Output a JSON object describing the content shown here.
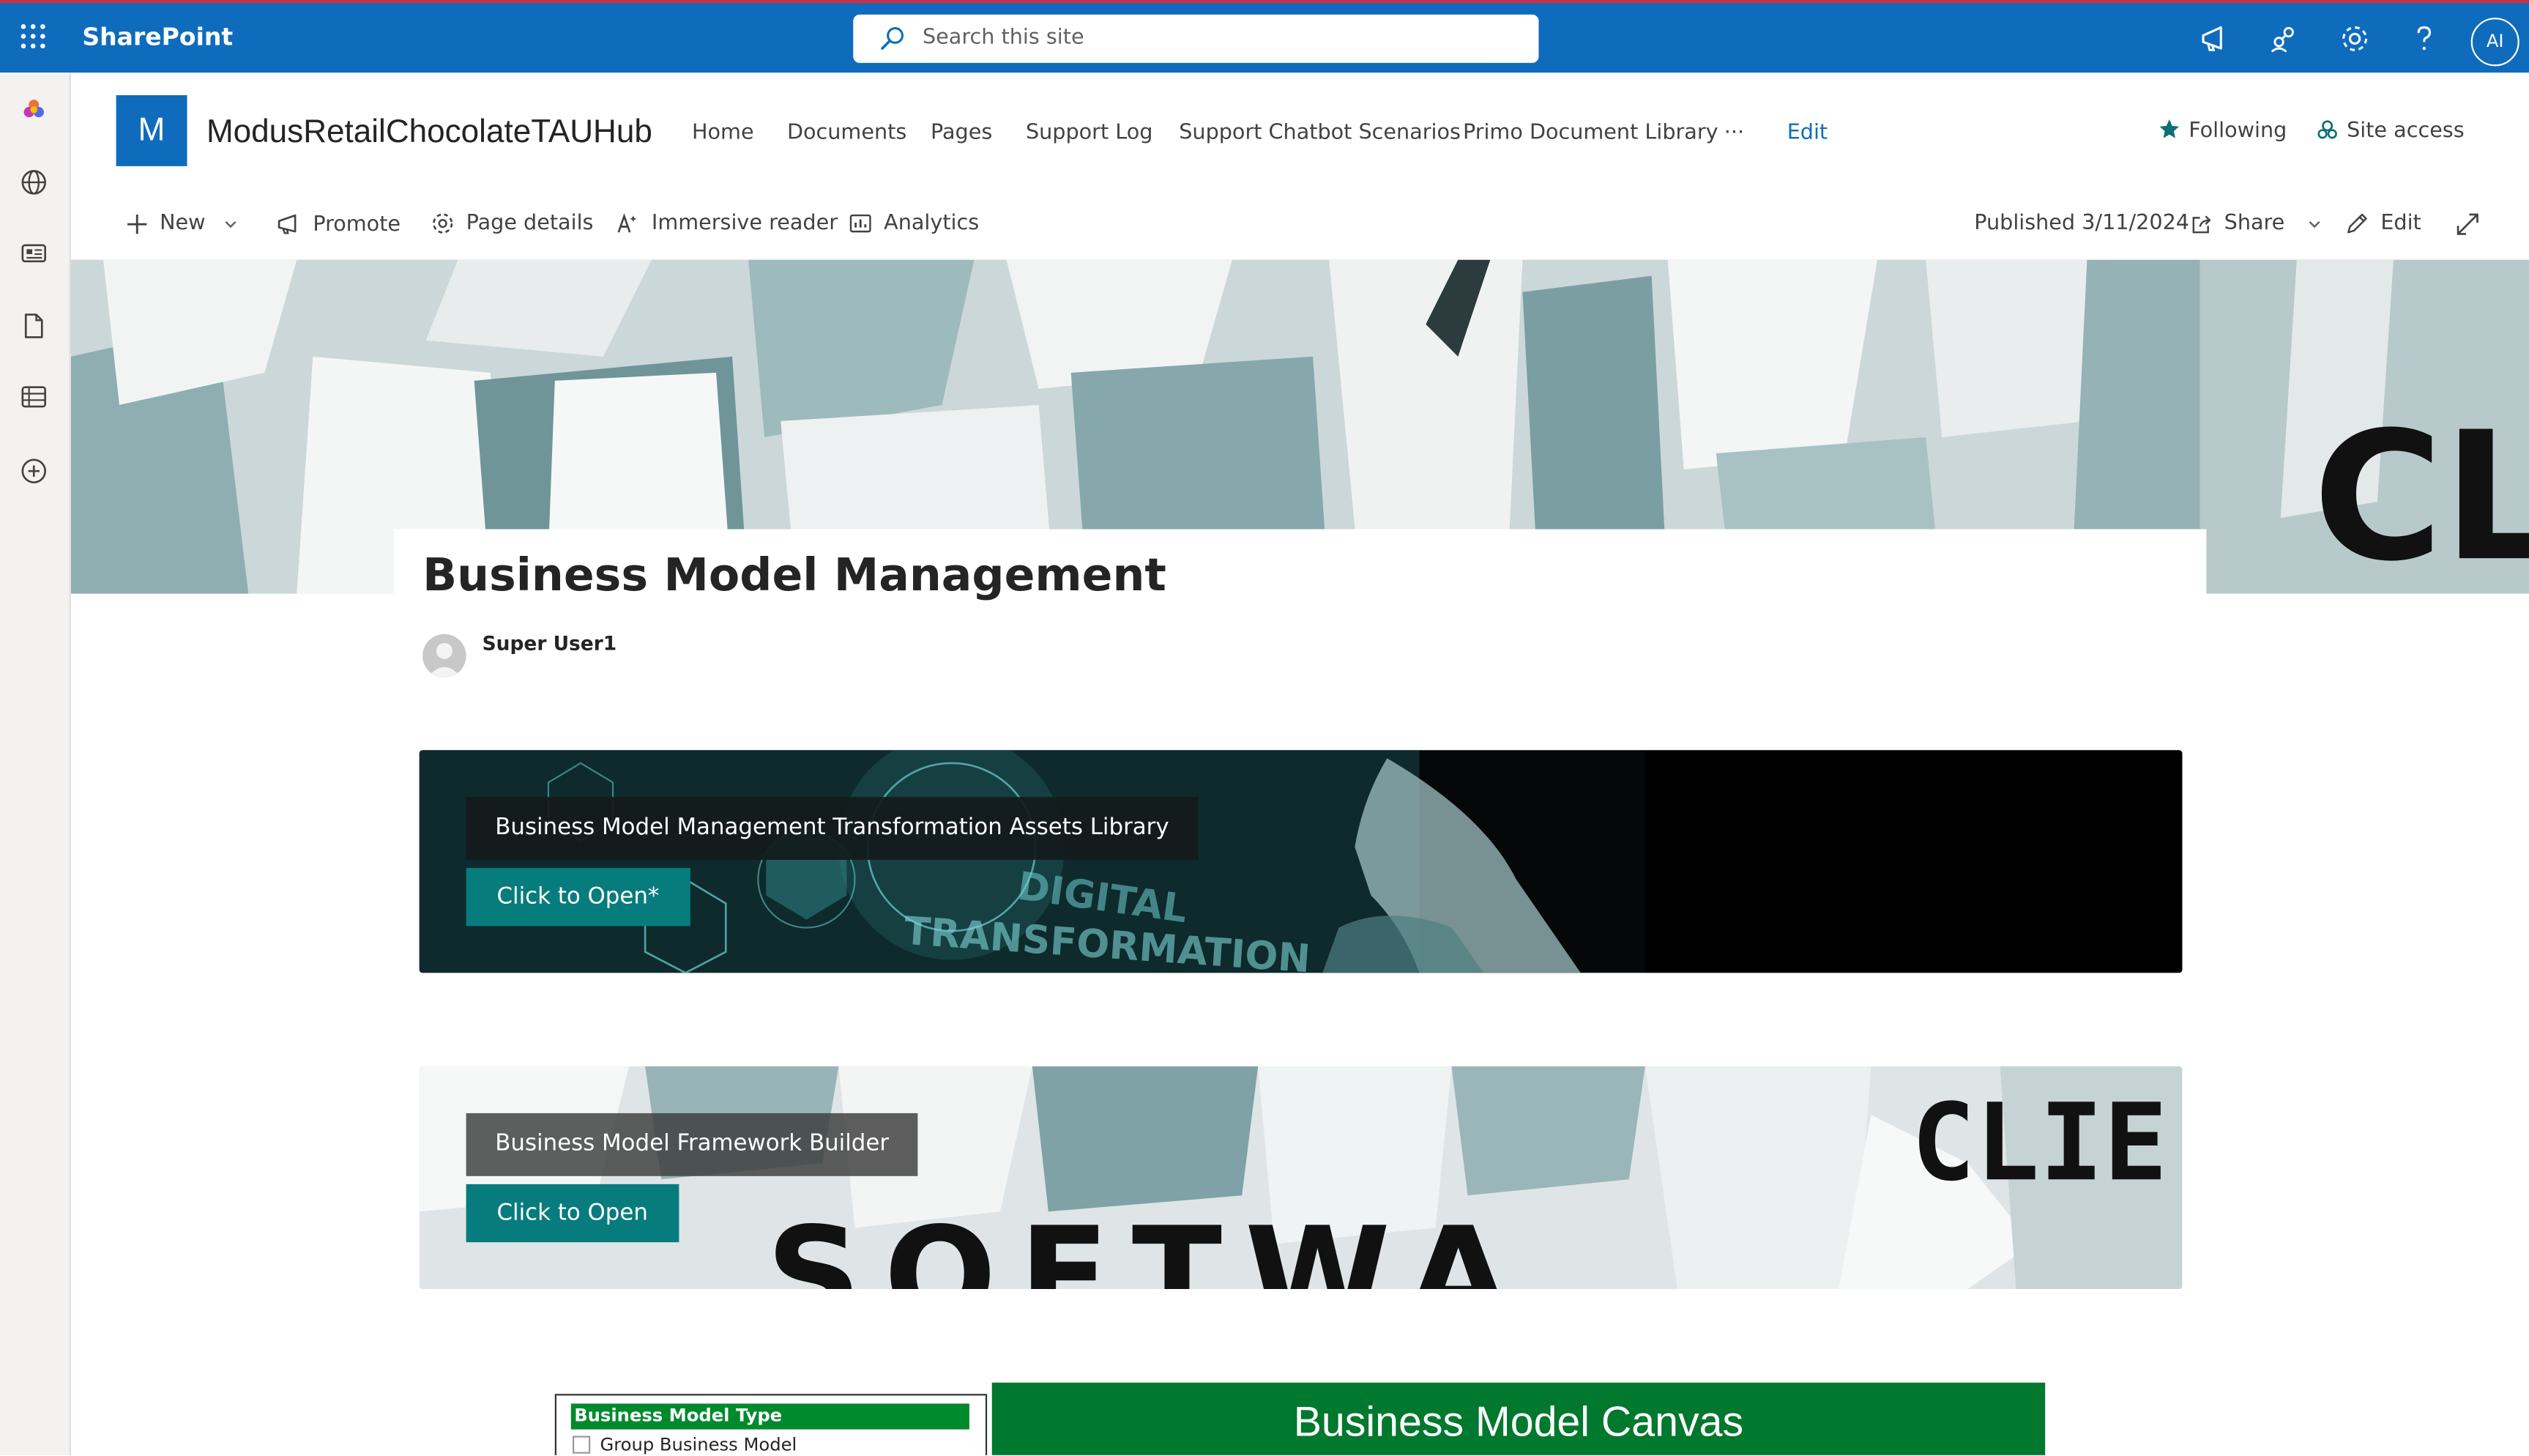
{
  "suite_bar": {
    "brand": "SharePoint",
    "search_placeholder": "Search this site",
    "avatar_initials": "AI",
    "icons": [
      "app-launcher-icon",
      "megaphone-icon",
      "share-people-icon",
      "gear-icon",
      "help-icon"
    ]
  },
  "left_rail": {
    "icons": [
      "sharepoint-home-icon",
      "globe-icon",
      "news-icon",
      "file-icon",
      "list-icon",
      "create-icon"
    ]
  },
  "site": {
    "logo_letter": "M",
    "title": "ModusRetailChocolateTAUHub",
    "nav": [
      "Home",
      "Documents",
      "Pages",
      "Support Log",
      "Support Chatbot Scenarios",
      "Primo Document Library"
    ],
    "more": "···",
    "edit": "Edit",
    "following": "Following",
    "site_access": "Site access"
  },
  "command_bar": {
    "new": "New",
    "promote": "Promote",
    "page_details": "Page details",
    "immersive_reader": "Immersive reader",
    "analytics": "Analytics",
    "published": "Published 3/11/2024",
    "share": "Share",
    "edit": "Edit"
  },
  "page": {
    "title": "Business Model Management",
    "author": "Super User1"
  },
  "banners": [
    {
      "label": "Business Model Management Transformation Assets Library",
      "button": "Click to Open*",
      "image_text": [
        "DIGITAL",
        "TRANSFORMATION"
      ]
    },
    {
      "label": "Business Model Framework Builder",
      "button": "Click to Open",
      "image_text": [
        "CLIE",
        "SOFTWA"
      ]
    }
  ],
  "hero_image_text": "CL",
  "bottom": {
    "type_header": "Business Model Type",
    "type_option": "Group Business Model",
    "canvas_title": "Business Model Canvas"
  },
  "colors": {
    "suite_bar": "#0f6cbd",
    "accent_teal": "#077c7d",
    "canvas_green": "#00782d"
  }
}
